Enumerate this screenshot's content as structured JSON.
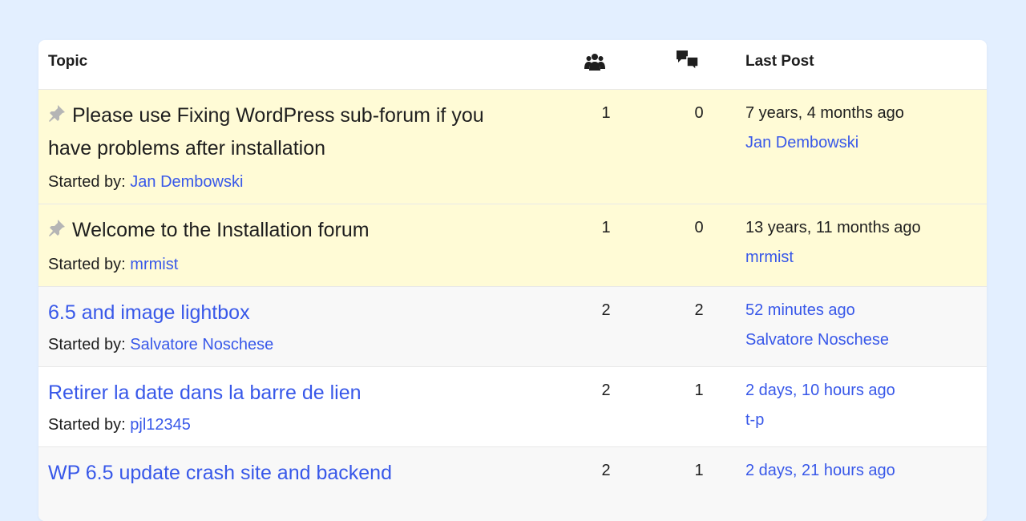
{
  "header": {
    "topic_label": "Topic",
    "voices_icon": "users-icon",
    "posts_icon": "comments-icon",
    "last_post_label": "Last Post"
  },
  "started_prefix": "Started by:",
  "topics": [
    {
      "sticky": true,
      "title": "Please use Fixing WordPress sub-forum if you have problems after installation",
      "starter": "Jan Dembowski",
      "voices": "1",
      "posts": "0",
      "last_post_time": "7 years, 4 months ago",
      "last_post_author": "Jan Dembowski"
    },
    {
      "sticky": true,
      "title": "Welcome to the Installation forum",
      "starter": "mrmist",
      "voices": "1",
      "posts": "0",
      "last_post_time": "13 years, 11 months ago",
      "last_post_author": "mrmist"
    },
    {
      "sticky": false,
      "title": "6.5 and image lightbox",
      "starter": "Salvatore Noschese",
      "voices": "2",
      "posts": "2",
      "last_post_time": "52 minutes ago",
      "last_post_author": "Salvatore Noschese"
    },
    {
      "sticky": false,
      "title": "Retirer la date dans la barre de lien",
      "starter": "pjl12345",
      "voices": "2",
      "posts": "1",
      "last_post_time": "2 days, 10 hours ago",
      "last_post_author": "t-p"
    },
    {
      "sticky": false,
      "title": "WP 6.5 update crash site and backend",
      "starter": "",
      "voices": "2",
      "posts": "1",
      "last_post_time": "2 days, 21 hours ago",
      "last_post_author": ""
    }
  ],
  "colors": {
    "page_bg": "#e3efff",
    "sticky_bg": "#fffbd6",
    "link": "#3858e9"
  }
}
